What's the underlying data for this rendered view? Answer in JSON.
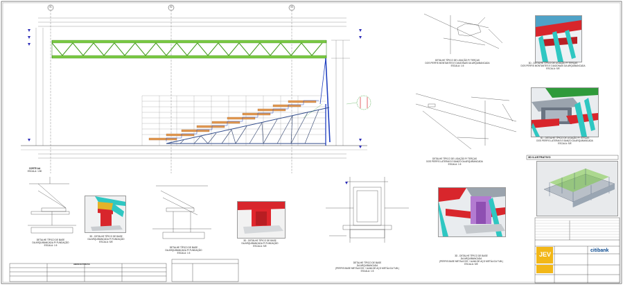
{
  "axes": {
    "a1": "01",
    "a2": "02",
    "a3": "03"
  },
  "main_elevation": {
    "title": "CORTE AA",
    "scale": "ESCALA: 1:50"
  },
  "details": {
    "d1": {
      "title": "DETALHE TÍPICO DE BASE",
      "sub": "DA ARQUIBANCADA P/ FUNDAÇÃO",
      "scale": "ESCALA: 1:5"
    },
    "d2": {
      "title": "3D - DETALHE TÍPICO DE BASE",
      "sub": "DA ARQUIBANCADA P/ FUNDAÇÃO",
      "scale": "ESCALA: S/E"
    },
    "d3": {
      "title": "DETALHE TÍPICO DE BASE",
      "sub": "DA ARQUIBANCADA P/ FUNDAÇÃO",
      "scale": "ESCALA: 1:5"
    },
    "d4": {
      "title": "3D - DETALHE TÍPICO DE BASE",
      "sub": "DA ARQUIBANCADA P/ FUNDAÇÃO",
      "scale": "ESCALA: S/E"
    },
    "d5": {
      "title": "DETALHE TÍPICO DE BASE",
      "sub": "DA ARQUIBANCADA",
      "sub2": "(PERFIS BASE METÁLICOS + ALMA DE AÇO METÁLICA TUB.)",
      "scale": "ESCALA: 1:5"
    },
    "d6": {
      "title": "3D - DETALHE TÍPICO DE BASE",
      "sub": "DA ARQUIBANCADA",
      "sub2": "(PERFIS BASE METÁLICOS + ALMA DE AÇO METÁLICA TUB.)",
      "scale": "ESCALA: S/E"
    },
    "d7": {
      "title": "DETALHE TÍPICO DE LIGAÇÃO P/ TERÇAS",
      "sub": "DOS PERFIS MONTANTES E DIAGONAIS DA ARQUIBANCADA",
      "scale": "ESCALA: 1:5"
    },
    "d8": {
      "title": "3D - DETALHE TÍPICO DE LIGAÇÃO P/ TERÇAS",
      "sub": "DOS PERFIS MONTANTES E DIAGONAIS DA ARQUIBANCADA",
      "scale": "ESCALA: S/E"
    },
    "d9": {
      "title": "DETALHE TÍPICO DE LIGAÇÃO P/ TERÇAS",
      "sub": "DOS PERFIS LATERAIS E BANZO DA ARQUIBANCADA",
      "scale": "ESCALA: 1:5"
    },
    "d10": {
      "title": "3D - DETALHE TÍPICO DE LIGAÇÃO P/ TERÇAS",
      "sub": "DOS PERFIS LATERAIS E BANZO DA ARQUIBANCADA",
      "scale": "ESCALA: S/E"
    }
  },
  "iso_title": "3D ILUSTRATIVO",
  "title_block": {
    "brand": "citibank",
    "company": "JEV"
  },
  "legend": {
    "title": "ABREVIATURAS"
  },
  "colors": {
    "green_truss": "#7ac943",
    "blue_member": "#1f3fbf",
    "red_member": "#d8262c",
    "cyan_member": "#2fc7c2",
    "orange_step": "#e39a52"
  }
}
